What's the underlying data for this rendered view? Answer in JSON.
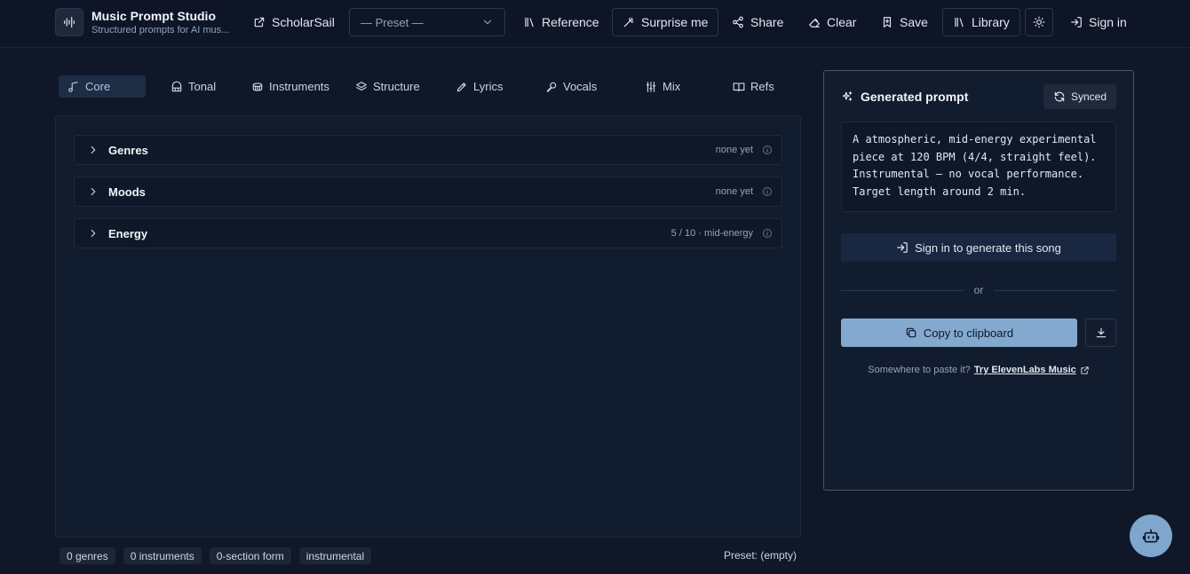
{
  "brand": {
    "title": "Music Prompt Studio",
    "subtitle": "Structured prompts for AI mus..."
  },
  "header": {
    "scholarsail": "ScholarSail",
    "preset_placeholder": "— Preset —",
    "reference": "Reference",
    "surprise": "Surprise me",
    "share": "Share",
    "clear": "Clear",
    "save": "Save",
    "library": "Library",
    "signin": "Sign in"
  },
  "tabs": [
    {
      "label": "Core",
      "icon": "music-note-icon",
      "active": true
    },
    {
      "label": "Tonal",
      "icon": "piano-icon"
    },
    {
      "label": "Instruments",
      "icon": "drum-icon"
    },
    {
      "label": "Structure",
      "icon": "layers-icon"
    },
    {
      "label": "Lyrics",
      "icon": "pen-icon"
    },
    {
      "label": "Vocals",
      "icon": "microphone-icon"
    },
    {
      "label": "Mix",
      "icon": "sliders-icon"
    },
    {
      "label": "Refs",
      "icon": "book-icon"
    }
  ],
  "sections": [
    {
      "title": "Genres",
      "status": "none yet"
    },
    {
      "title": "Moods",
      "status": "none yet"
    },
    {
      "title": "Energy",
      "status": "5 / 10 · mid-energy"
    }
  ],
  "footer": {
    "chips": [
      "0 genres",
      "0 instruments",
      "0-section form",
      "instrumental"
    ],
    "preset_status": "Preset: (empty)"
  },
  "side": {
    "title": "Generated prompt",
    "synced": "Synced",
    "prompt_lines": [
      "A atmospheric, mid-energy experimental",
      "piece at 120 BPM (4/4, straight feel).",
      "Instrumental — no vocal performance.",
      "Target length around 2 min."
    ],
    "signin_generate": "Sign in to generate this song",
    "or": "or",
    "copy": "Copy to clipboard",
    "paste_prompt": "Somewhere to paste it?",
    "paste_link": "Try ElevenLabs Music"
  },
  "colors": {
    "background": "#0f1729",
    "accent": "#83a9cf",
    "active_tab": "#1f2d44"
  }
}
